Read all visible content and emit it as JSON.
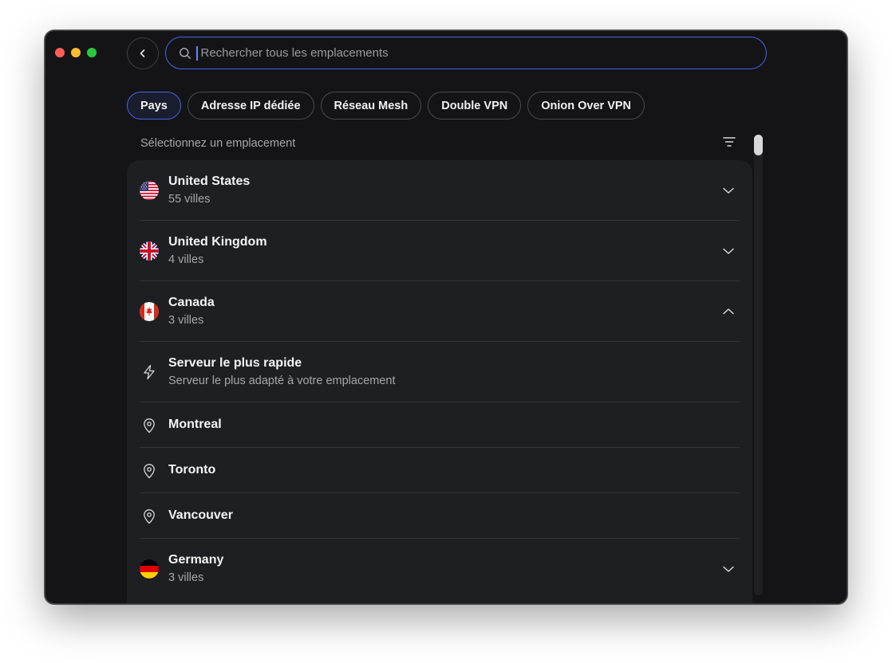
{
  "search": {
    "placeholder": "Rechercher tous les emplacements",
    "value": ""
  },
  "tabs": [
    {
      "label": "Pays",
      "active": true
    },
    {
      "label": "Adresse IP dédiée",
      "active": false
    },
    {
      "label": "Réseau Mesh",
      "active": false
    },
    {
      "label": "Double VPN",
      "active": false
    },
    {
      "label": "Onion Over VPN",
      "active": false
    }
  ],
  "list": {
    "section_label": "Sélectionnez un emplacement",
    "items": [
      {
        "title": "United States",
        "subtitle": "55 villes",
        "icon": "us-flag-icon",
        "expanded": false
      },
      {
        "title": "United Kingdom",
        "subtitle": "4 villes",
        "icon": "uk-flag-icon",
        "expanded": false
      },
      {
        "title": "Canada",
        "subtitle": "3 villes",
        "icon": "canada-flag-icon",
        "expanded": true
      },
      {
        "title": "Serveur le plus rapide",
        "subtitle": "Serveur le plus adapté à votre emplacement",
        "icon": "lightning-icon"
      },
      {
        "title": "Montreal",
        "icon": "location-pin-icon"
      },
      {
        "title": "Toronto",
        "icon": "location-pin-icon"
      },
      {
        "title": "Vancouver",
        "icon": "location-pin-icon"
      },
      {
        "title": "Germany",
        "subtitle": "3 villes",
        "icon": "germany-flag-icon",
        "expanded": false
      }
    ]
  },
  "colors": {
    "accent": "#4763e4",
    "window_bg": "#141416",
    "panel_bg": "#1e1f22"
  }
}
